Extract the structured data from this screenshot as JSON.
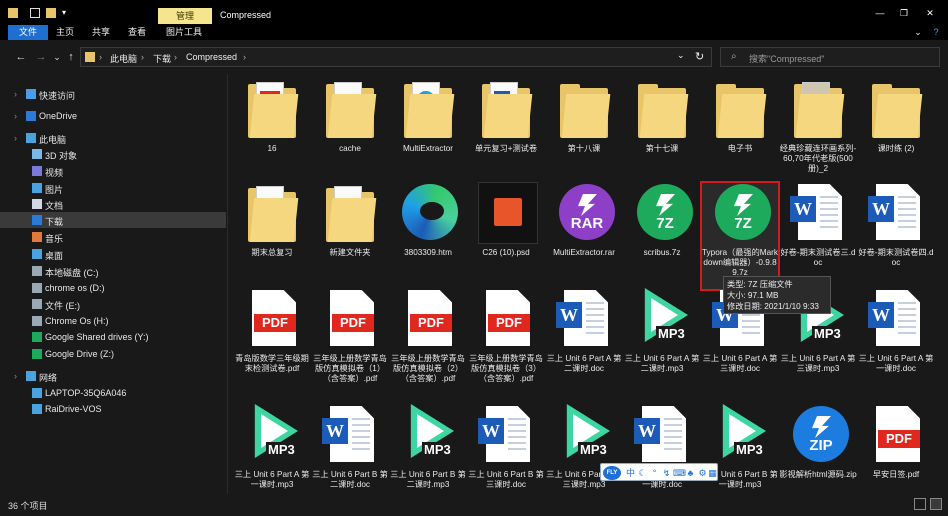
{
  "window": {
    "context_tab": "管理",
    "title": "Compressed",
    "minimize": "—",
    "restore": "❐",
    "close": "✕"
  },
  "ribbon": {
    "tabs": [
      "文件",
      "主页",
      "共享",
      "查看",
      "图片工具"
    ],
    "active_tab": "文件",
    "accent": "#1f6fd0"
  },
  "nav": {
    "back": "←",
    "forward": "→",
    "recent": "⌄",
    "up": "↑",
    "breadcrumb": [
      "此电脑",
      "下载",
      "Compressed"
    ],
    "separator": "›",
    "refresh": "↻",
    "search_placeholder": "搜索\"Compressed\""
  },
  "sidebar": {
    "items": [
      {
        "label": "快速访问",
        "icon": "star-icon",
        "indent": 1
      },
      {
        "label": "OneDrive",
        "icon": "cloud-icon",
        "indent": 1
      },
      {
        "label": "此电脑",
        "icon": "computer-icon",
        "indent": 1
      },
      {
        "label": "3D 对象",
        "icon": "cube-icon",
        "indent": 2
      },
      {
        "label": "视频",
        "icon": "video-icon",
        "indent": 2
      },
      {
        "label": "图片",
        "icon": "picture-icon",
        "indent": 2
      },
      {
        "label": "文档",
        "icon": "document-icon",
        "indent": 2
      },
      {
        "label": "下载",
        "icon": "download-icon",
        "indent": 2,
        "selected": true
      },
      {
        "label": "音乐",
        "icon": "music-icon",
        "indent": 2
      },
      {
        "label": "桌面",
        "icon": "desktop-icon",
        "indent": 2
      },
      {
        "label": "本地磁盘 (C:)",
        "icon": "drive-icon",
        "indent": 2
      },
      {
        "label": "chrome os (D:)",
        "icon": "drive-icon",
        "indent": 2
      },
      {
        "label": "文件 (E:)",
        "icon": "drive-icon",
        "indent": 2
      },
      {
        "label": "Chrome Os (H:)",
        "icon": "drive-icon",
        "indent": 2
      },
      {
        "label": "Google Shared drives (Y:)",
        "icon": "google-drive-icon",
        "indent": 2
      },
      {
        "label": "Google Drive (Z:)",
        "icon": "google-drive-icon",
        "indent": 2
      },
      {
        "label": "网络",
        "icon": "network-icon",
        "indent": 1
      },
      {
        "label": "LAPTOP-35Q6A046",
        "icon": "monitor-icon",
        "indent": 2
      },
      {
        "label": "RaiDrive-VOS",
        "icon": "monitor-icon",
        "indent": 2
      }
    ]
  },
  "files": [
    {
      "name": "16",
      "kind": "folder-doc"
    },
    {
      "name": "cache",
      "kind": "folder-paper"
    },
    {
      "name": "MultiExtractor",
      "kind": "folder-edge"
    },
    {
      "name": "单元复习+测试卷",
      "kind": "folder-word"
    },
    {
      "name": "第十八课",
      "kind": "folder"
    },
    {
      "name": "第十七课",
      "kind": "folder"
    },
    {
      "name": "电子书",
      "kind": "folder"
    },
    {
      "name": "经典珍藏连环画系列-60,70年代老版(500册)_2",
      "kind": "folder-book"
    },
    {
      "name": "课时练 (2)",
      "kind": "folder"
    },
    {
      "name": "期末总复习",
      "kind": "folder-paper"
    },
    {
      "name": "新建文件夹",
      "kind": "folder-paper"
    },
    {
      "name": "3803309.htm",
      "kind": "edge"
    },
    {
      "name": "C26 (10).psd",
      "kind": "psd"
    },
    {
      "name": "MultiExtractor.rar",
      "kind": "rar"
    },
    {
      "name": "scribus.7z",
      "kind": "7z"
    },
    {
      "name": "Typora（最强的Markdown编辑器）-0.9.89.7z",
      "kind": "7z",
      "selected": true
    },
    {
      "name": "好卷-期末测试卷三.doc",
      "kind": "word"
    },
    {
      "name": "好卷-期末测试卷四.doc",
      "kind": "word"
    },
    {
      "name": "青岛版数学三年级期末检测试卷.pdf",
      "kind": "pdf"
    },
    {
      "name": "三年级上册数学青岛版仿真模拟卷（1）（含答案）.pdf",
      "kind": "pdf"
    },
    {
      "name": "三年级上册数学青岛版仿真模拟卷（2）（含答案）.pdf",
      "kind": "pdf"
    },
    {
      "name": "三年级上册数学青岛版仿真模拟卷（3）（含答案）.pdf",
      "kind": "pdf"
    },
    {
      "name": "三上 Unit 6 Part A 第二课时.doc",
      "kind": "word"
    },
    {
      "name": "三上 Unit 6 Part A 第二课时.mp3",
      "kind": "mp3"
    },
    {
      "name": "三上 Unit 6 Part A 第三课时.doc",
      "kind": "word"
    },
    {
      "name": "三上 Unit 6 Part A 第三课时.mp3",
      "kind": "mp3"
    },
    {
      "name": "三上 Unit 6 Part A 第一课时.doc",
      "kind": "word"
    },
    {
      "name": "三上 Unit 6 Part A 第一课时.mp3",
      "kind": "mp3"
    },
    {
      "name": "三上 Unit 6 Part B 第二课时.doc",
      "kind": "word"
    },
    {
      "name": "三上 Unit 6 Part B 第二课时.mp3",
      "kind": "mp3"
    },
    {
      "name": "三上 Unit 6 Part B 第三课时.doc",
      "kind": "word"
    },
    {
      "name": "三上 Unit 6 Part B 第三课时.mp3",
      "kind": "mp3"
    },
    {
      "name": "三上 Unit 6 Part B 第一课时.doc",
      "kind": "word"
    },
    {
      "name": "三上 Unit 6 Part B 第一课时.mp3",
      "kind": "mp3"
    },
    {
      "name": "影视解析html源码.zip",
      "kind": "zip"
    },
    {
      "name": "早安日签.pdf",
      "kind": "pdf"
    }
  ],
  "tooltip": {
    "type": "类型: 7Z 压缩文件",
    "size": "大小: 97.1 MB",
    "modified": "修改日期: 2021/1/10 9:33"
  },
  "floatbar": {
    "fly": "FLY",
    "items": [
      "中",
      "☾",
      "°",
      "↯",
      "⌨",
      "♣",
      "⚙",
      "▦"
    ]
  },
  "status": {
    "count": "36 个项目"
  },
  "colors": {
    "folder": "#e9c569",
    "word": "#1d5bb8",
    "pdf": "#e0281f",
    "mp3": "#3ed6a0",
    "rar": "#8e3fc7",
    "7z": "#1eaa5d",
    "zip": "#1c7ce0",
    "selection_border": "#d01c1c"
  }
}
